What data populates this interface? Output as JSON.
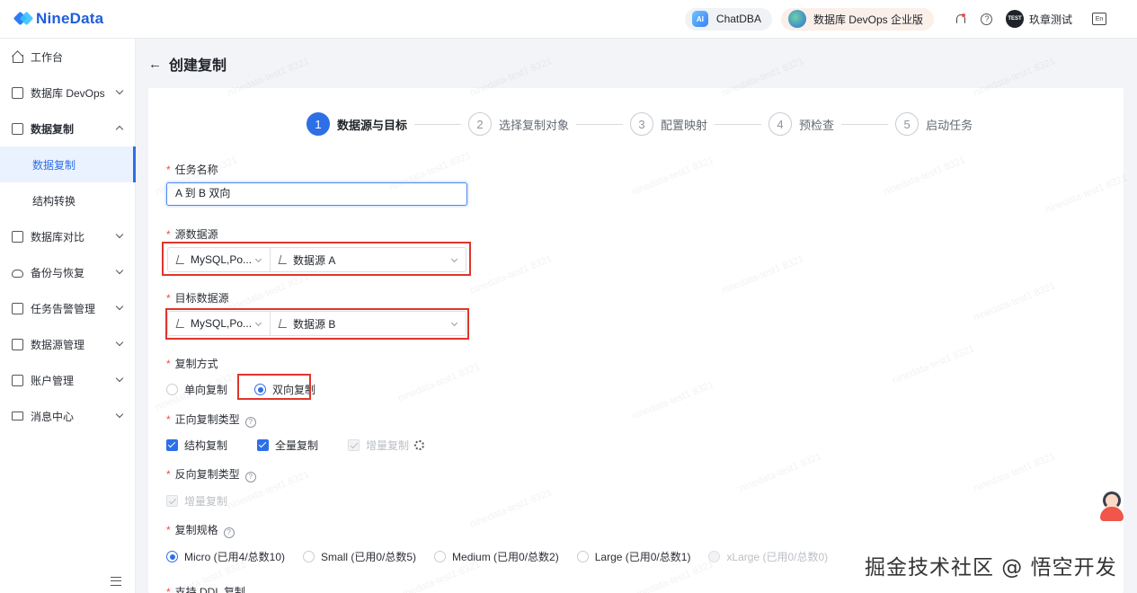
{
  "header": {
    "logo_text": "NineData",
    "chatdba_badge": "AI",
    "chatdba_label": "ChatDBA",
    "devops_label": "数据库 DevOps 企业版",
    "avatar_text": "TEST",
    "user_name": "玖章测试",
    "lang_glyph": "En"
  },
  "sidebar": {
    "items": [
      {
        "label": "工作台"
      },
      {
        "label": "数据库 DevOps"
      },
      {
        "label": "数据复制"
      },
      {
        "label": "数据复制"
      },
      {
        "label": "结构转换"
      },
      {
        "label": "数据库对比"
      },
      {
        "label": "备份与恢复"
      },
      {
        "label": "任务告警管理"
      },
      {
        "label": "数据源管理"
      },
      {
        "label": "账户管理"
      },
      {
        "label": "消息中心"
      }
    ]
  },
  "page": {
    "back_arrow": "←",
    "title": "创建复制"
  },
  "steps": [
    {
      "num": "1",
      "label": "数据源与目标"
    },
    {
      "num": "2",
      "label": "选择复制对象"
    },
    {
      "num": "3",
      "label": "配置映射"
    },
    {
      "num": "4",
      "label": "预检查"
    },
    {
      "num": "5",
      "label": "启动任务"
    }
  ],
  "form": {
    "required_mark": "*",
    "hint_glyph": "?",
    "task_name_label": "任务名称",
    "task_name_value": "A 到 B 双向",
    "source_label": "源数据源",
    "source_type": "MySQL,Po...",
    "source_ds": "数据源 A",
    "target_label": "目标数据源",
    "target_type": "MySQL,Po...",
    "target_ds": "数据源 B",
    "mode_label": "复制方式",
    "mode_one_way": "单向复制",
    "mode_two_way": "双向复制",
    "forward_label": "正向复制类型",
    "forward_structure": "结构复制",
    "forward_full": "全量复制",
    "forward_incremental": "增量复制",
    "reverse_label": "反向复制类型",
    "reverse_incremental": "增量复制",
    "spec_label": "复制规格",
    "spec_options": [
      {
        "label": "Micro (已用4/总数10)"
      },
      {
        "label": "Small (已用0/总数5)"
      },
      {
        "label": "Medium (已用0/总数2)"
      },
      {
        "label": "Large (已用0/总数1)"
      },
      {
        "label": "xLarge (已用0/总数0)"
      }
    ],
    "cut_label": "支持 DDL 复制"
  },
  "watermark_text": "ninedata-test1 8321",
  "footer_watermark": "掘金技术社区 @ 悟空开发"
}
